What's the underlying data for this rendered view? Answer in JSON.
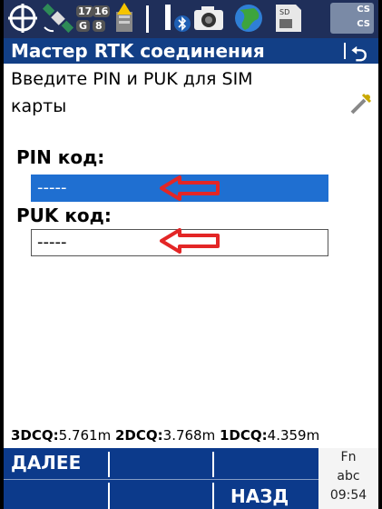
{
  "status_bar": {
    "icons": [
      "crosshair-icon",
      "satellite-icon",
      "gnss-counts-icon",
      "rtk-warning-icon",
      "tripod-icon",
      "bluetooth-icon",
      "camera-icon",
      "globe-icon",
      "memory-card-icon",
      "cs-icon"
    ],
    "sat_counts": [
      "17",
      "16"
    ],
    "gnss_labels": [
      "G",
      "8"
    ],
    "cs_labels": [
      "CS",
      "CS"
    ]
  },
  "title_bar": {
    "title": "Мастер RTK соединения",
    "back_symbol": "⮌"
  },
  "instruction": "Введите PIN и  PUK для SIM карты",
  "form": {
    "pin": {
      "label": "PIN код:",
      "value": "-----"
    },
    "puk": {
      "label": "PUK код:",
      "value": "-----"
    }
  },
  "precision": {
    "3d_label": "3DCQ:",
    "3d_value": "5.761m",
    "2d_label": "2DCQ:",
    "2d_value": "3.768m",
    "1d_label": "1DCQ:",
    "1d_value": "4.359m"
  },
  "softkeys": {
    "next": "ДАЛЕЕ",
    "back": "НАЗД",
    "fn": "Fn",
    "input_mode": "abc",
    "time": "09:54"
  },
  "colors": {
    "title_bg": "#123f86",
    "softkey_bg": "#0c3a8b",
    "field_highlight": "#1f6fd1",
    "arrow": "#e32626"
  }
}
